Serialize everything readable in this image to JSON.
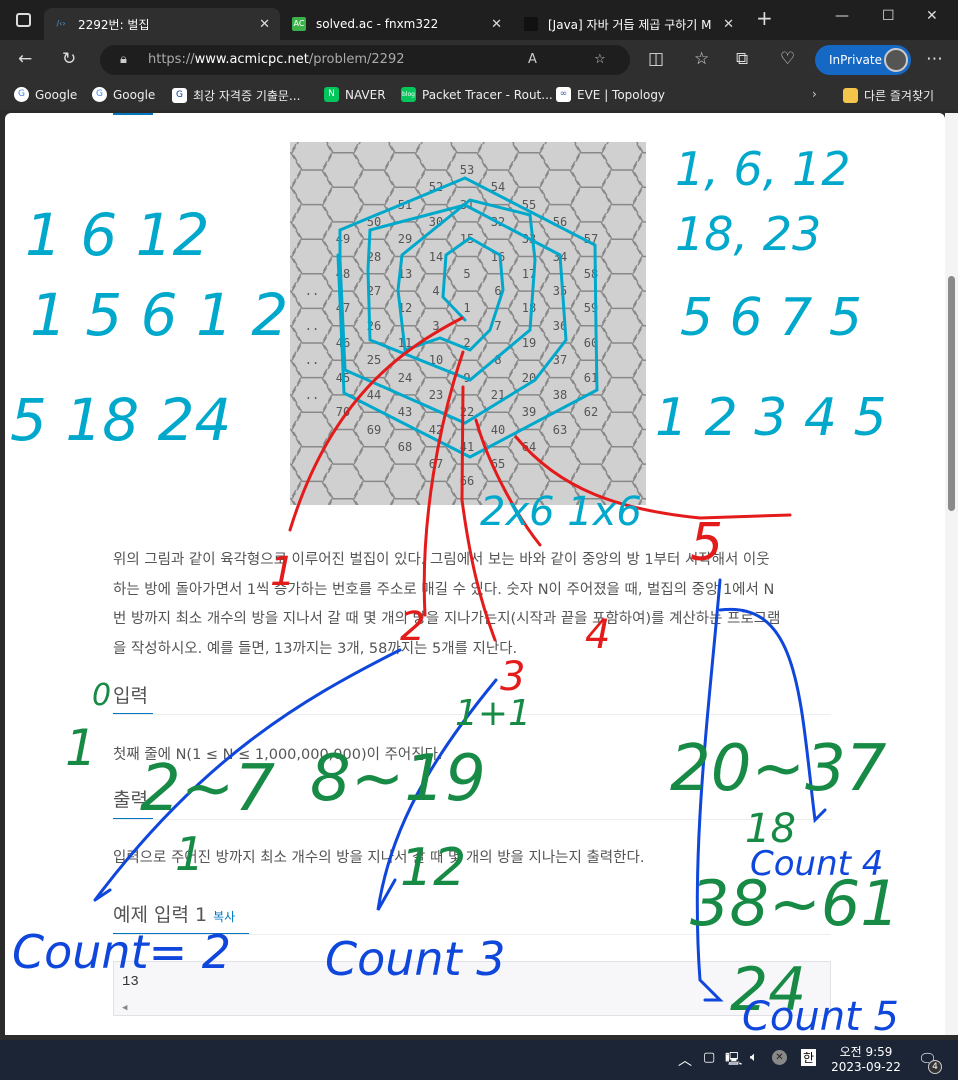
{
  "browser": {
    "tabs": [
      {
        "title": "2292번: 벌집",
        "active": true,
        "icon": "acmicpc-icon"
      },
      {
        "title": "solved.ac - fnxm322",
        "active": false,
        "icon": "solvedac-icon",
        "icon_text": "AC"
      },
      {
        "title": "[Java] 자바 거듭 제곱 구하기 M",
        "active": false,
        "icon": "factory-icon"
      }
    ],
    "url_prefix": "https://",
    "url_domain": "www.acmicpc.net",
    "url_path": "/problem/2292",
    "inprivate_label": "InPrivate",
    "bookmarks": [
      {
        "label": "Google",
        "icon": "google-icon"
      },
      {
        "label": "Google",
        "icon": "google-icon"
      },
      {
        "label": "최강 자격증 기출문...",
        "icon": "gsc-icon"
      },
      {
        "label": "NAVER",
        "icon": "naver-icon"
      },
      {
        "label": "Packet Tracer - Rout...",
        "icon": "blog-icon"
      },
      {
        "label": "EVE | Topology",
        "icon": "eve-icon"
      }
    ],
    "other_favorites": "다른 즐겨찾기"
  },
  "problem": {
    "hex_cells": [
      "53",
      "52",
      "54",
      "51",
      "31",
      "55",
      "50",
      "30",
      "32",
      "56",
      "49",
      "29",
      "15",
      "33",
      "57",
      "28",
      "14",
      "16",
      "34",
      "48",
      "13",
      "5",
      "17",
      "58",
      "..",
      "27",
      "4",
      "6",
      "35",
      "47",
      "12",
      "1",
      "18",
      "59",
      "..",
      "26",
      "3",
      "7",
      "36",
      "46",
      "11",
      "2",
      "19",
      "60",
      "..",
      "25",
      "10",
      "8",
      "37",
      "45",
      "24",
      "9",
      "20",
      "61",
      "..",
      "44",
      "23",
      "21",
      "38",
      "70",
      "43",
      "22",
      "39",
      "62",
      "69",
      "42",
      "40",
      "63",
      "68",
      "41",
      "64",
      "67",
      "65",
      "66"
    ],
    "description": [
      "위의 그림과 같이 육각형으로 이루어진 벌집이 있다. 그림에서 보는 바와 같이 중앙의 방 1부터 시작해서 이웃",
      "하는 방에 돌아가면서 1씩 증가하는 번호를 주소로 매길 수 있다. 숫자 N이 주어졌을 때, 벌집의 중앙 1에서 N",
      "번 방까지 최소 개수의 방을 지나서 갈 때 몇 개의 방을 지나가는지(시작과 끝을 포함하여)를 계산하는 프로그램",
      "을 작성하시오. 예를 들면, 13까지는 3개, 58까지는 5개를 지난다."
    ],
    "input_heading": "입력",
    "input_text": "첫째 줄에 N(1 ≤ N ≤ 1,000,000,000)이 주어진다.",
    "output_heading": "출력",
    "output_text": "입력으로 주어진 방까지 최소 개수의 방을 지나서 갈 때 몇 개의 방을 지나는지 출력한다.",
    "sample_heading": "예제 입력 1",
    "copy_label": "복사",
    "sample_input": "13"
  },
  "annotations": {
    "teal": [
      "1 6 12",
      "1 5 6 1 2",
      "5 18 24",
      "1, 6, 12",
      "18, 23",
      "5 6 7 5",
      "1 2 3 4 5",
      "2x6 1x6"
    ],
    "red": [
      "1",
      "2",
      "3",
      "4",
      "5"
    ],
    "green": [
      "0",
      "1",
      "2~7",
      "1+1",
      "8~19",
      "20~37",
      "1",
      "12",
      "18",
      "38~61",
      "24"
    ],
    "blue": [
      "Count= 2",
      "Count 3",
      "Count 4",
      "Count 5"
    ],
    "colors": {
      "teal": "#00a8cc",
      "red": "#e41b1b",
      "green": "#178a45",
      "blue": "#0f46db"
    }
  },
  "taskbar": {
    "time": "오전 9:59",
    "date": "2023-09-22",
    "ime": "한",
    "notifications": "4"
  }
}
